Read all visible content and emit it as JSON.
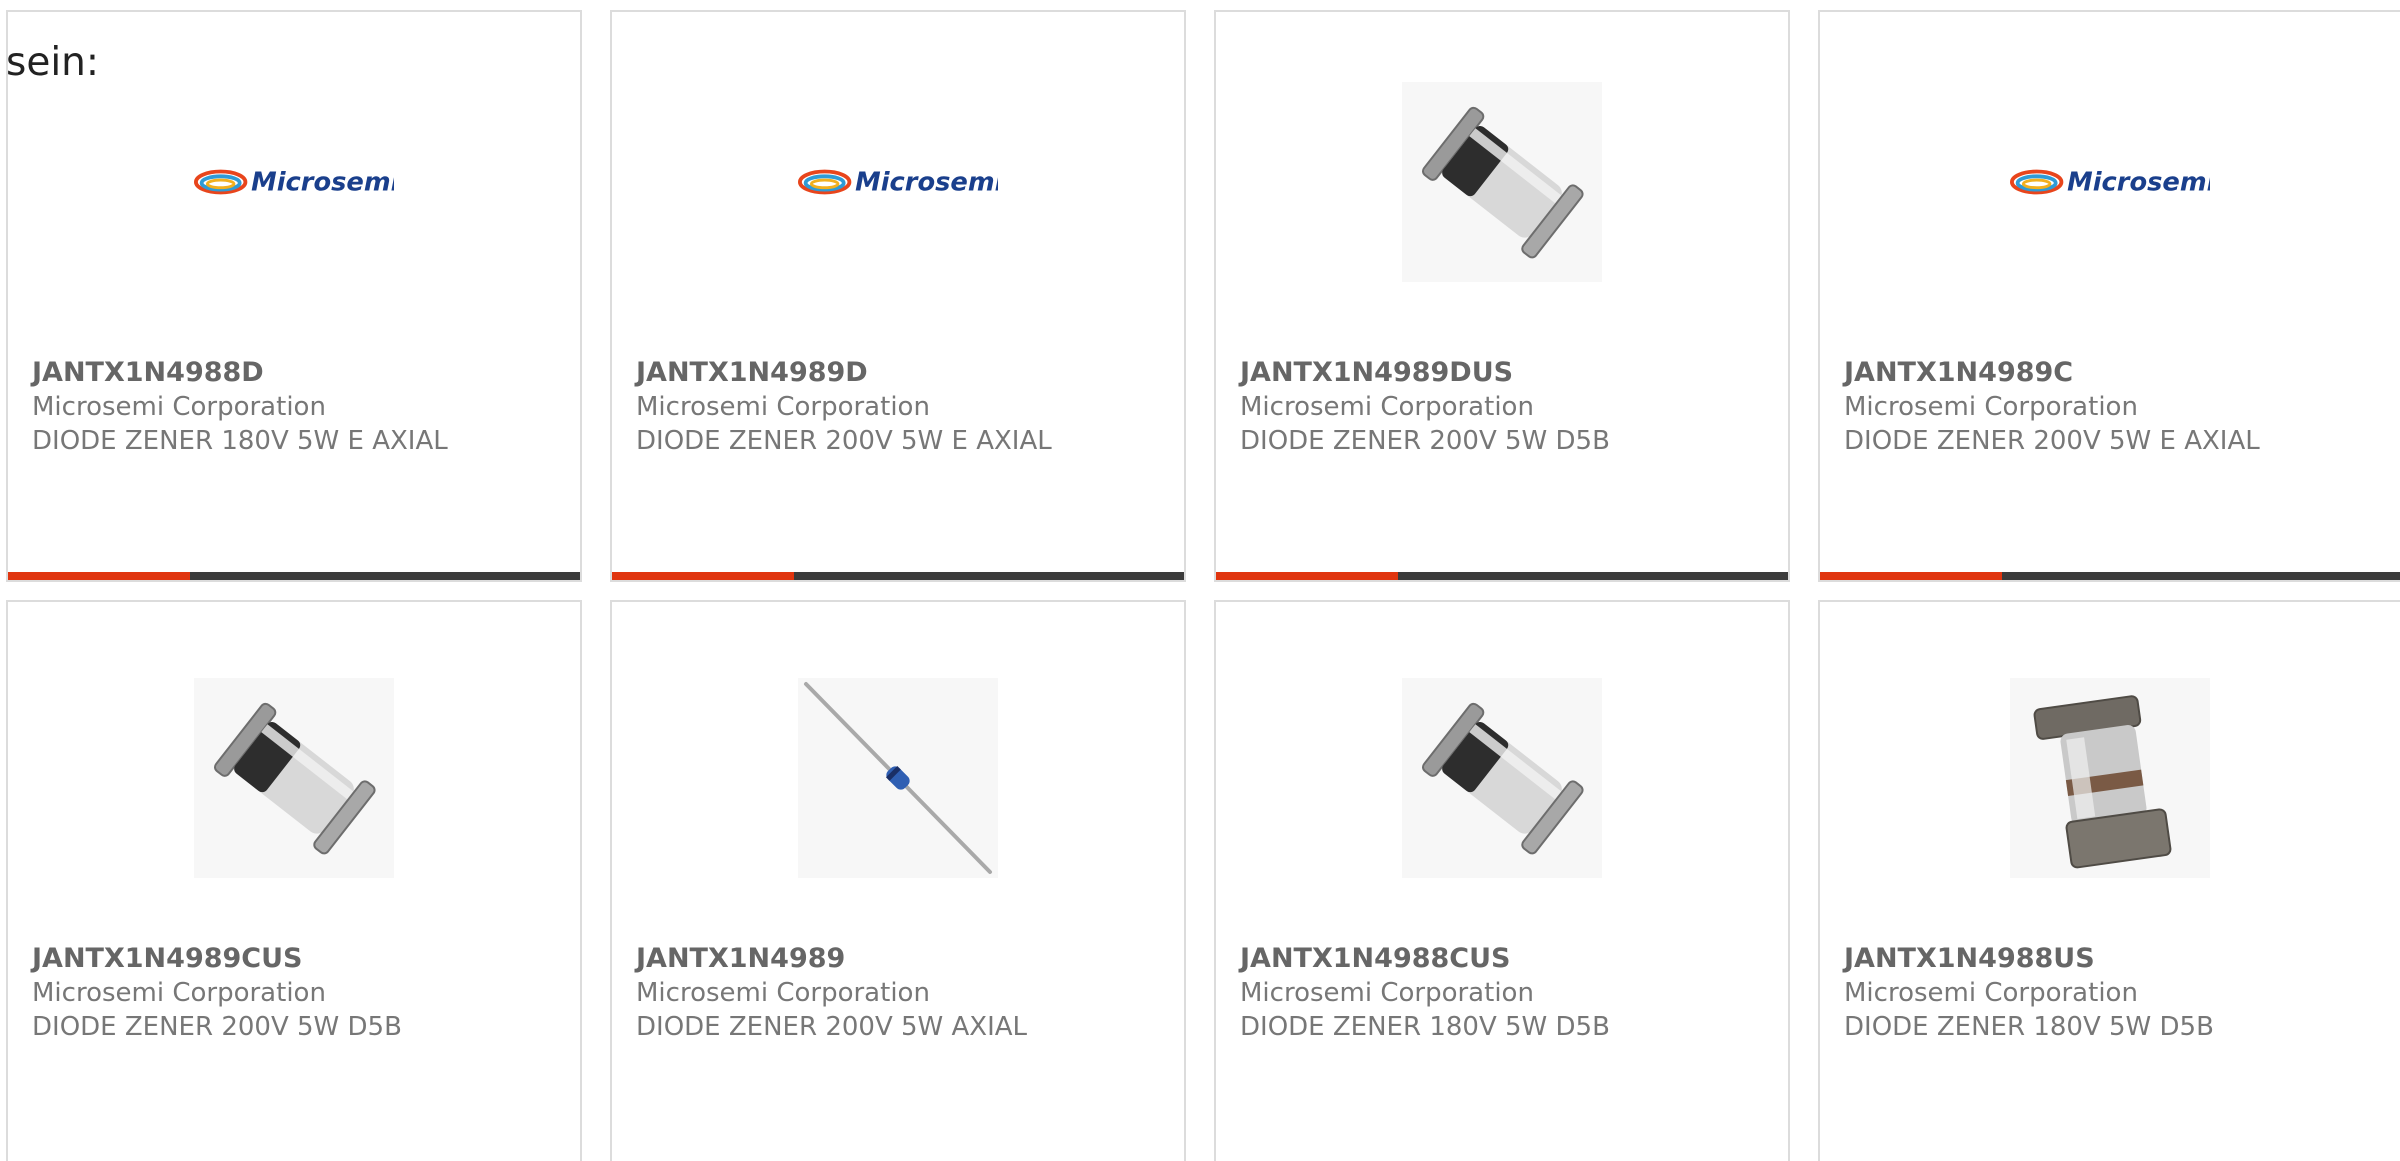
{
  "intro_text": "sein:",
  "colors": {
    "accent": "#e0350f",
    "bar": "#3b3b3b",
    "border": "#dcdcdc"
  },
  "products": [
    {
      "part": "JANTX1N4988D",
      "manufacturer": "Microsemi Corporation",
      "description": "DIODE ZENER 180V 5W E AXIAL",
      "image": "microsemi-logo"
    },
    {
      "part": "JANTX1N4989D",
      "manufacturer": "Microsemi Corporation",
      "description": "DIODE ZENER 200V 5W E AXIAL",
      "image": "microsemi-logo"
    },
    {
      "part": "JANTX1N4989DUS",
      "manufacturer": "Microsemi Corporation",
      "description": "DIODE ZENER 200V 5W D5B",
      "image": "d5b-package-photo"
    },
    {
      "part": "JANTX1N4989C",
      "manufacturer": "Microsemi Corporation",
      "description": "DIODE ZENER 200V 5W E AXIAL",
      "image": "microsemi-logo"
    },
    {
      "part": "JANTX1N4989CUS",
      "manufacturer": "Microsemi Corporation",
      "description": "DIODE ZENER 200V 5W D5B",
      "image": "d5b-package-photo"
    },
    {
      "part": "JANTX1N4989",
      "manufacturer": "Microsemi Corporation",
      "description": "DIODE ZENER 200V 5W AXIAL",
      "image": "axial-diode-photo"
    },
    {
      "part": "JANTX1N4988CUS",
      "manufacturer": "Microsemi Corporation",
      "description": "DIODE ZENER 180V 5W D5B",
      "image": "d5b-package-photo"
    },
    {
      "part": "JANTX1N4988US",
      "manufacturer": "Microsemi Corporation",
      "description": "DIODE ZENER 180V 5W D5B",
      "image": "square-package-photo"
    }
  ],
  "logo_text": "Microsemi"
}
